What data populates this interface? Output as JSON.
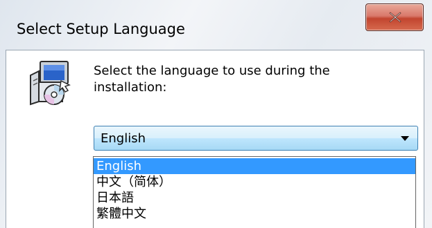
{
  "window": {
    "title": "Select Setup Language"
  },
  "icons": {
    "close": "close-icon",
    "setup": "setup-computer-cd-icon",
    "dropdown_arrow": "chevron-down-icon"
  },
  "main": {
    "prompt": "Select the language to use during the installation:",
    "language_select": {
      "selected": "English"
    }
  },
  "dropdown": {
    "options": [
      "English",
      "中文（简体）",
      "日本語",
      "繁體中文"
    ],
    "highlighted_index": 0
  },
  "colors": {
    "selection": "#3399ff",
    "close_button": "#c2452f"
  }
}
